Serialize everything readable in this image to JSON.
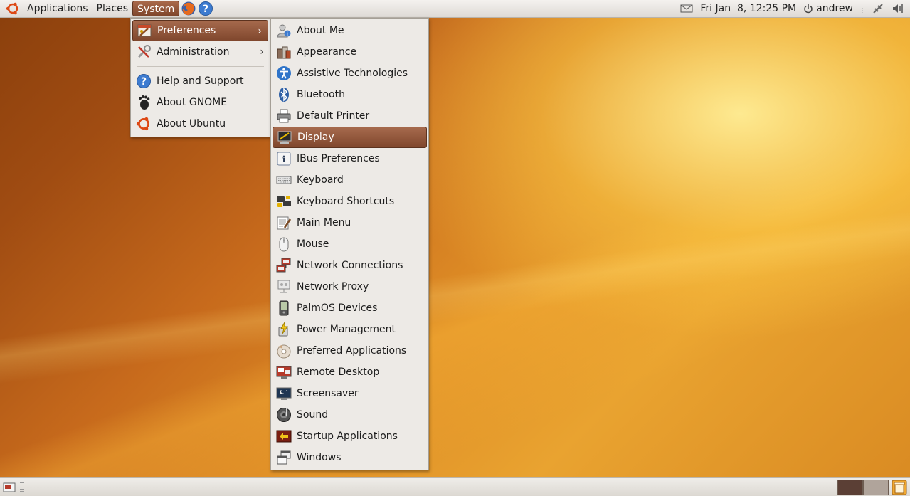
{
  "top_panel": {
    "menus": [
      "Applications",
      "Places",
      "System"
    ],
    "active_menu": "System",
    "clock": "Fri Jan  8, 12:25 PM",
    "user": "andrew",
    "icons": [
      "ubuntu-logo",
      "firefox-icon",
      "help-icon",
      "mail-icon",
      "power-icon",
      "network-icon",
      "volume-icon"
    ]
  },
  "system_menu": {
    "items": [
      {
        "label": "Preferences",
        "icon": "preferences-icon",
        "submenu": true
      },
      {
        "label": "Administration",
        "icon": "administration-icon",
        "submenu": true
      },
      {
        "label": "Help and Support",
        "icon": "help-icon"
      },
      {
        "label": "About GNOME",
        "icon": "gnome-foot-icon"
      },
      {
        "label": "About Ubuntu",
        "icon": "ubuntu-logo-icon"
      }
    ],
    "submenu_arrow": "›"
  },
  "preferences_menu": {
    "highlighted": "Display",
    "items": [
      {
        "label": "About Me",
        "icon": "about-me-icon"
      },
      {
        "label": "Appearance",
        "icon": "appearance-icon"
      },
      {
        "label": "Assistive Technologies",
        "icon": "accessibility-icon"
      },
      {
        "label": "Bluetooth",
        "icon": "bluetooth-icon"
      },
      {
        "label": "Default Printer",
        "icon": "printer-icon"
      },
      {
        "label": "Display",
        "icon": "display-icon"
      },
      {
        "label": "IBus Preferences",
        "icon": "ibus-icon"
      },
      {
        "label": "Keyboard",
        "icon": "keyboard-icon"
      },
      {
        "label": "Keyboard Shortcuts",
        "icon": "keyboard-shortcuts-icon"
      },
      {
        "label": "Main Menu",
        "icon": "main-menu-icon"
      },
      {
        "label": "Mouse",
        "icon": "mouse-icon"
      },
      {
        "label": "Network Connections",
        "icon": "network-connections-icon"
      },
      {
        "label": "Network Proxy",
        "icon": "network-proxy-icon"
      },
      {
        "label": "PalmOS Devices",
        "icon": "palm-device-icon"
      },
      {
        "label": "Power Management",
        "icon": "power-management-icon"
      },
      {
        "label": "Preferred Applications",
        "icon": "preferred-apps-icon"
      },
      {
        "label": "Remote Desktop",
        "icon": "remote-desktop-icon"
      },
      {
        "label": "Screensaver",
        "icon": "screensaver-icon"
      },
      {
        "label": "Sound",
        "icon": "sound-icon"
      },
      {
        "label": "Startup Applications",
        "icon": "startup-apps-icon"
      },
      {
        "label": "Windows",
        "icon": "windows-icon"
      }
    ]
  },
  "bottom_panel": {
    "workspaces": 2,
    "active_workspace": 1
  },
  "colors": {
    "highlight": "#8f5236",
    "panel": "#e6e3de",
    "desktop_accent": "#e9a330"
  }
}
